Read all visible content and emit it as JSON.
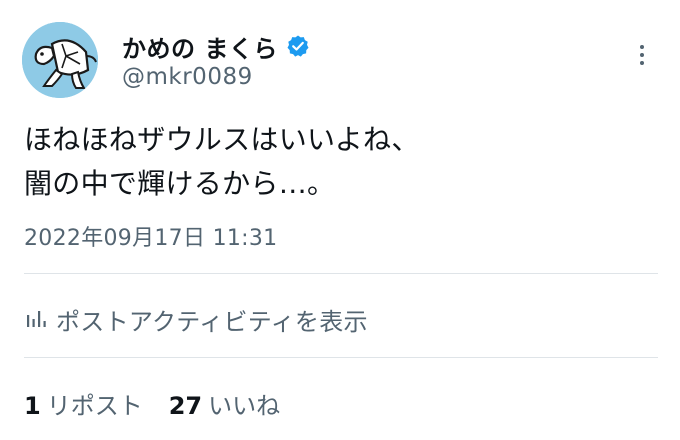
{
  "user": {
    "display_name": "かめの まくら",
    "handle": "@mkr0089",
    "verified": true,
    "avatar_icon": "turtle-avatar-icon"
  },
  "menu": {
    "icon": "more-vertical-icon"
  },
  "tweet": {
    "lines": [
      "ほねほねザウルスはいいよね、",
      "闇の中で輝けるから…。"
    ],
    "timestamp": "2022年09月17日 11:31"
  },
  "activity": {
    "icon": "bar-chart-icon",
    "label": "ポストアクティビティを表示"
  },
  "stats": {
    "reposts": {
      "count": "1",
      "label": "リポスト"
    },
    "likes": {
      "count": "27",
      "label": "いいね"
    }
  },
  "colors": {
    "text": "#0f1419",
    "secondary": "#536471",
    "verified_blue": "#1d9bf0",
    "divider": "#dfe4e8",
    "avatar_bg": "#8ecae6"
  }
}
